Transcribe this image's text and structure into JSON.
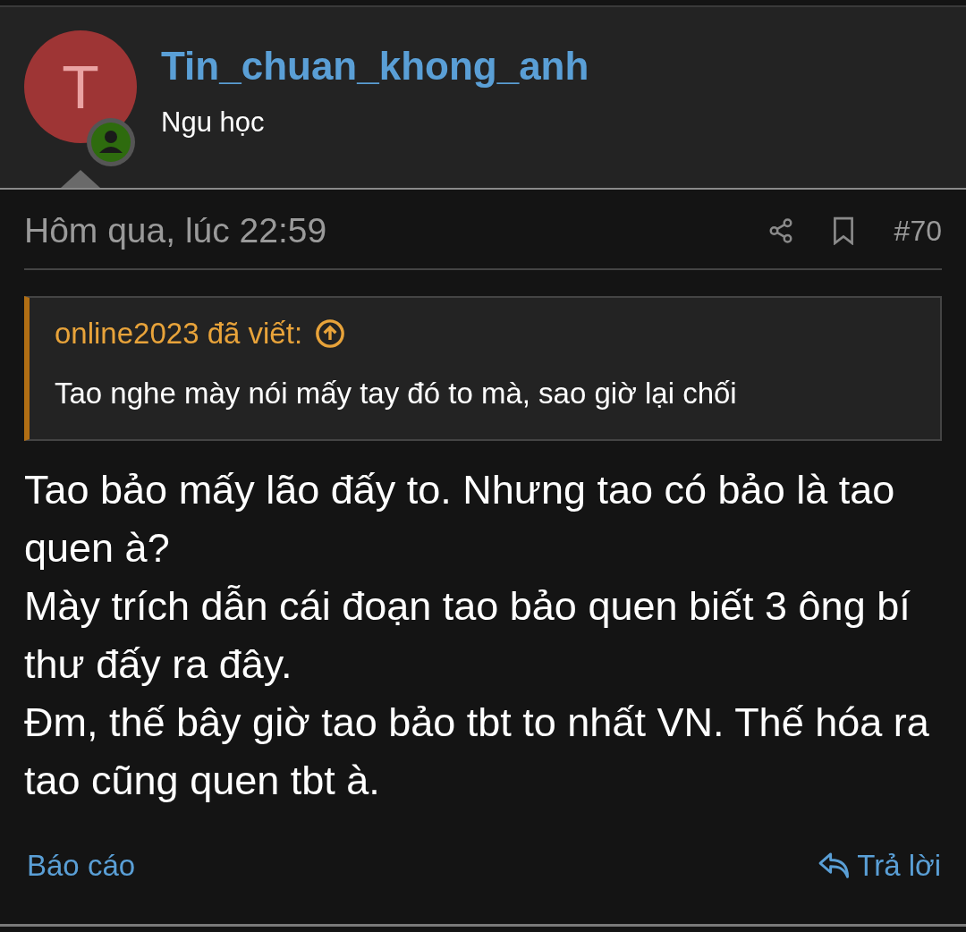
{
  "author": {
    "avatar_letter": "T",
    "username": "Tin_chuan_khong_anh",
    "title": "Ngu học"
  },
  "post": {
    "time": "Hôm qua, lúc 22:59",
    "number": "#70",
    "quote": {
      "author_line": "online2023 đã viết:",
      "text": "Tao nghe mày nói mấy tay đó to mà, sao giờ lại chối"
    },
    "paragraphs": [
      "Tao bảo mấy lão đấy to. Nhưng tao có bảo là tao quen à?",
      "Mày trích dẫn cái đoạn tao bảo quen biết 3 ông bí thư đấy ra đây.",
      "Đm, thế bây giờ tao bảo tbt to nhất VN. Thế hóa ra tao cũng quen tbt à."
    ],
    "actions": {
      "report": "Báo cáo",
      "reply": "Trả lời"
    }
  }
}
